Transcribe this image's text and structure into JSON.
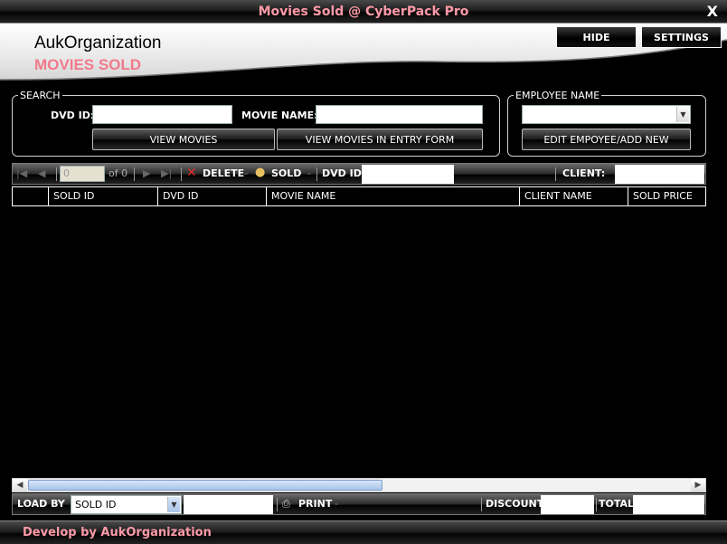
{
  "window": {
    "title": "Movies Sold @ CyberPack Pro",
    "close_label": "X"
  },
  "header": {
    "org_name": "AukOrganization",
    "page_title": "MOVIES SOLD",
    "hide_label": "HIDE",
    "settings_label": "SETTINGS"
  },
  "search": {
    "legend": "SEARCH",
    "dvd_id_label": "DVD ID:",
    "dvd_id_value": "",
    "movie_name_label": "MOVIE NAME:",
    "movie_name_value": "",
    "view_movies_label": "VIEW MOVIES",
    "view_in_form_label": "VIEW MOVIES IN ENTRY FORM"
  },
  "employee": {
    "legend": "EMPLOYEE NAME",
    "selected": "",
    "edit_label": "EDIT EMPOYEE/ADD NEW"
  },
  "navigator": {
    "position": "0",
    "of_count": "of 0",
    "delete_label": "DELETE",
    "sold_label": "SOLD",
    "dvd_id_label": "DVD ID:",
    "dvd_id_value": "",
    "client_label": "CLIENT:",
    "client_value": ""
  },
  "grid": {
    "columns": [
      "",
      "SOLD ID",
      "DVD ID",
      "MOVIE NAME",
      "CLIENT NAME",
      "SOLD PRICE"
    ],
    "rows": []
  },
  "bottom": {
    "load_by_label": "LOAD BY",
    "load_by_selected": "SOLD ID",
    "load_value": "",
    "print_label": "PRINT",
    "discount_label": "DISCOUNT",
    "discount_value": "",
    "total_label": "TOTAL",
    "total_value": ""
  },
  "footer": {
    "credit": "Develop by AukOrganization"
  },
  "colors": {
    "accent_pink": "#ff9aa8",
    "title_pink": "#f17a8c",
    "background": "#000000"
  }
}
